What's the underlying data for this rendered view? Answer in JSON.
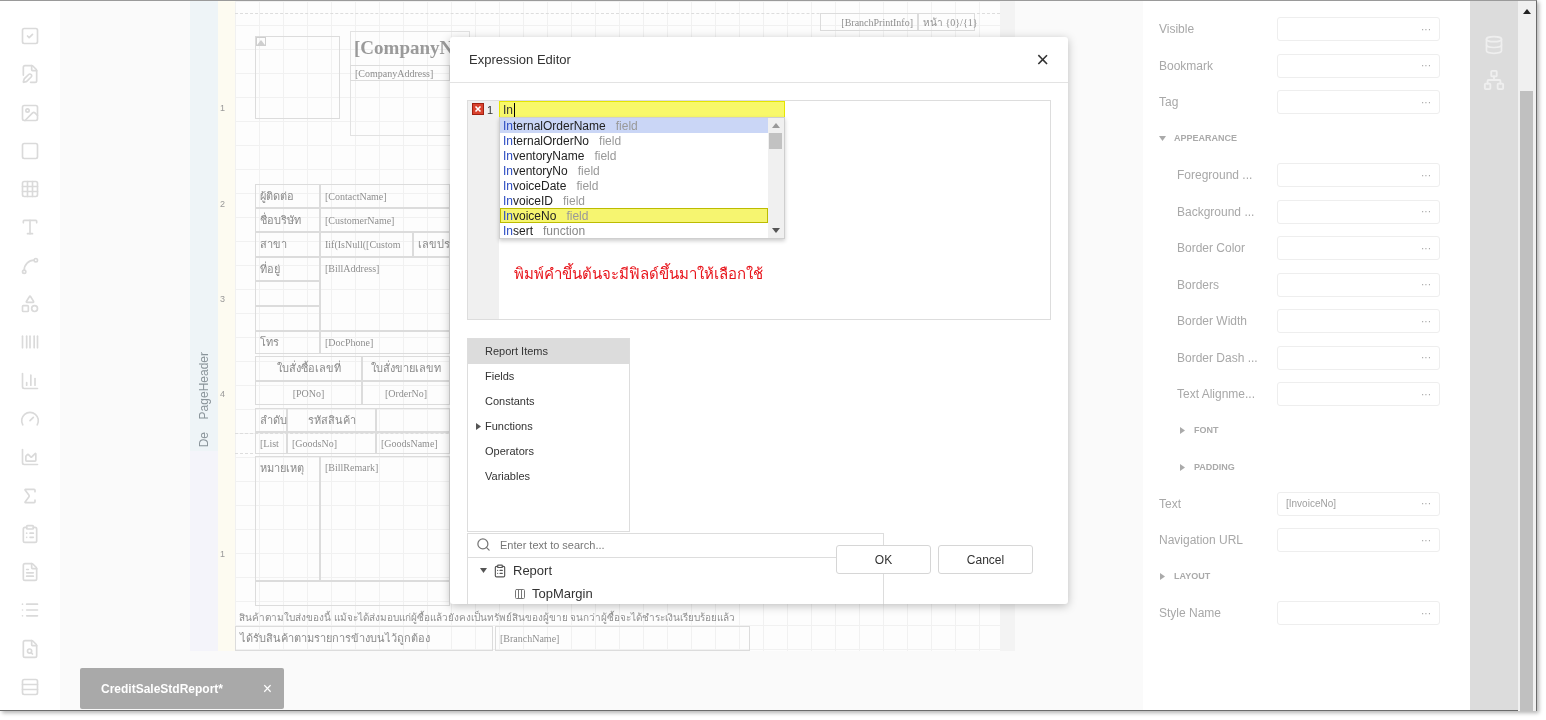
{
  "report": {
    "band_labels": [
      "PageHeader",
      "De"
    ],
    "ruler_marks": [
      "1",
      "2",
      "3",
      "4",
      "1"
    ],
    "controls": [
      {
        "text": "[BranchPrintInfo]",
        "kind": "field"
      },
      {
        "text": "หน้า {0}/{1}",
        "kind": "field"
      },
      {
        "text": "[CompanyN",
        "kind": "title"
      },
      {
        "text": "[CompanyAddress]",
        "kind": "field"
      },
      {
        "text": "ผู้ติดต่อ",
        "kind": "label"
      },
      {
        "text": "[ContactName]",
        "kind": "field"
      },
      {
        "text": "ชื่อบริษัท",
        "kind": "label"
      },
      {
        "text": "[CustomerName]",
        "kind": "field"
      },
      {
        "text": "สาขา",
        "kind": "label"
      },
      {
        "text": "Iif(IsNull([Custom",
        "kind": "field"
      },
      {
        "text": "เลขปร",
        "kind": "label"
      },
      {
        "text": "ที่อยู่",
        "kind": "label"
      },
      {
        "text": "[BillAddress]",
        "kind": "field"
      },
      {
        "text": "โทร",
        "kind": "label"
      },
      {
        "text": "[DocPhone]",
        "kind": "field"
      },
      {
        "text": "ใบสั่งซื้อเลขที่",
        "kind": "label"
      },
      {
        "text": "ใบสั่งขายเลขท",
        "kind": "label"
      },
      {
        "text": "[PONo]",
        "kind": "field"
      },
      {
        "text": "[OrderNo]",
        "kind": "field"
      },
      {
        "text": "ลำดับ",
        "kind": "label"
      },
      {
        "text": "รหัสสินค้า",
        "kind": "label"
      },
      {
        "text": "[List",
        "kind": "field"
      },
      {
        "text": "[GoodsNo]",
        "kind": "field"
      },
      {
        "text": "[GoodsName]",
        "kind": "field"
      },
      {
        "text": "หมายเหตุ",
        "kind": "label"
      },
      {
        "text": "[BillRemark]",
        "kind": "field"
      },
      {
        "text": "สินค้าตามใบส่งของนี้ แม้จะได้ส่งมอบแก่ผู้ซื้อแล้วยังคงเป็นทรัพย์สินของผู้ขาย จนกว่าผู้ซื้อจะได้ชำระเงินเรียบร้อยแล้ว",
        "kind": "note"
      },
      {
        "text": "ได้รับสินค้าตามรายการข้างบนไว้ถูกต้อง",
        "kind": "label"
      },
      {
        "text": "[BranchName]",
        "kind": "field"
      }
    ]
  },
  "document_tab": {
    "title": "CreditSaleStdReport*",
    "close": "×"
  },
  "properties": [
    {
      "kind": "property",
      "label": "Visible",
      "action": "···"
    },
    {
      "kind": "property",
      "label": "Bookmark",
      "action": "···"
    },
    {
      "kind": "property",
      "label": "Tag",
      "action": "···"
    },
    {
      "kind": "section",
      "label": "APPEARANCE",
      "expanded": true,
      "children": [
        {
          "kind": "property",
          "label": "Foreground ...",
          "action": "···"
        },
        {
          "kind": "property",
          "label": "Background ...",
          "action": "···"
        },
        {
          "kind": "property",
          "label": "Border Color",
          "action": "···"
        },
        {
          "kind": "property",
          "label": "Borders",
          "action": "···"
        },
        {
          "kind": "property",
          "label": "Border Width",
          "action": "···"
        },
        {
          "kind": "property",
          "label": "Border Dash ...",
          "action": "···"
        },
        {
          "kind": "property",
          "label": "Text Alignme...",
          "action": "···"
        },
        {
          "kind": "section",
          "label": "FONT",
          "expanded": false
        },
        {
          "kind": "section",
          "label": "PADDING",
          "expanded": false
        }
      ]
    },
    {
      "kind": "property",
      "label": "Text",
      "value": "[InvoiceNo]",
      "action": "···"
    },
    {
      "kind": "property",
      "label": "Navigation URL",
      "action": "···"
    },
    {
      "kind": "section",
      "label": "LAYOUT",
      "expanded": false
    },
    {
      "kind": "property",
      "label": "Style Name",
      "action": "···"
    }
  ],
  "dialog": {
    "title": "Expression Editor",
    "close": "×",
    "editor": {
      "line_number": "1",
      "error": true,
      "text": "In",
      "highlighted": true
    },
    "suggestions": [
      {
        "name": "InternalOrderName",
        "type": "field",
        "selected": true,
        "highlighted": false
      },
      {
        "name": "InternalOrderNo",
        "type": "field",
        "selected": false,
        "highlighted": false
      },
      {
        "name": "InventoryName",
        "type": "field",
        "selected": false,
        "highlighted": false
      },
      {
        "name": "InventoryNo",
        "type": "field",
        "selected": false,
        "highlighted": false
      },
      {
        "name": "InvoiceDate",
        "type": "field",
        "selected": false,
        "highlighted": false
      },
      {
        "name": "InvoiceID",
        "type": "field",
        "selected": false,
        "highlighted": false
      },
      {
        "name": "InvoiceNo",
        "type": "field",
        "selected": false,
        "highlighted": true
      },
      {
        "name": "Insert",
        "type": "function",
        "selected": false,
        "highlighted": false
      }
    ],
    "annotation": "พิมพ์คำขึ้นต้นจะมีฟิลด์ขึ้นมาให้เลือกใช้",
    "categories": [
      {
        "label": "Report Items",
        "selected": true
      },
      {
        "label": "Fields",
        "selected": false
      },
      {
        "label": "Constants",
        "selected": false
      },
      {
        "label": "Functions",
        "selected": false,
        "expandable": true
      },
      {
        "label": "Operators",
        "selected": false
      },
      {
        "label": "Variables",
        "selected": false
      }
    ],
    "search": {
      "placeholder": "Enter text to search..."
    },
    "tree": [
      {
        "label": "Report",
        "expanded": true,
        "children": [
          {
            "label": "TopMargin"
          }
        ]
      }
    ],
    "buttons": [
      "OK",
      "Cancel"
    ]
  }
}
